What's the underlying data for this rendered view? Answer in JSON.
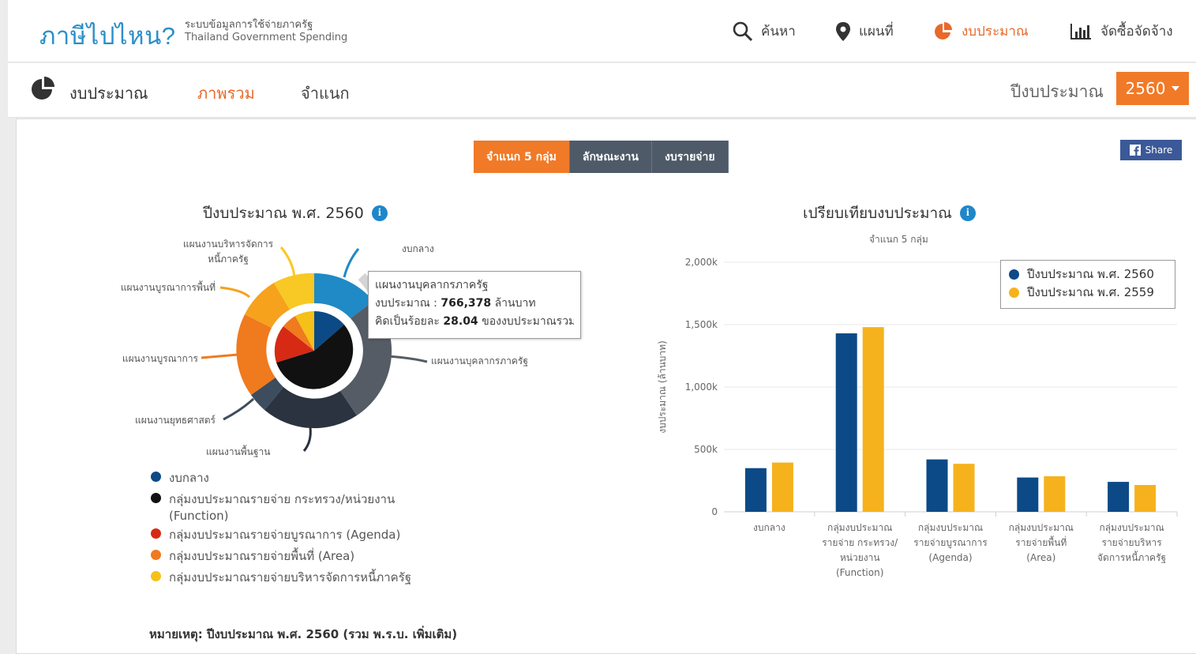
{
  "header": {
    "logo": "ภาษีไปไหน?",
    "subtitle_th": "ระบบข้อมูลการใช้จ่ายภาครัฐ",
    "subtitle_en": "Thailand Government Spending",
    "nav": [
      {
        "label": "ค้นหา",
        "icon": "search-icon"
      },
      {
        "label": "แผนที่",
        "icon": "map-pin-icon"
      },
      {
        "label": "งบประมาณ",
        "icon": "pie-chart-icon",
        "active": true
      },
      {
        "label": "จัดซื้อจัดจ้าง",
        "icon": "bar-chart-icon"
      }
    ]
  },
  "subnav": {
    "title": "งบประมาณ",
    "tabs": [
      {
        "label": "ภาพรวม",
        "active": true
      },
      {
        "label": "จำแนก"
      }
    ],
    "year_label": "ปีงบประมาณ",
    "year_value": "2560"
  },
  "toolbar": {
    "segments": [
      {
        "label": "จำแนก 5 กลุ่ม",
        "active": true
      },
      {
        "label": "ลักษณะงาน"
      },
      {
        "label": "งบรายจ่าย"
      }
    ],
    "share": "Share"
  },
  "donut": {
    "title": "ปีงบประมาณ พ.ศ. 2560",
    "labels": {
      "central": "งบกลาง",
      "admin_debt": [
        "แผนงานบริหารจัดการ",
        "หนี้ภาครัฐ"
      ],
      "area": "แผนงานบูรณาการพื้นที่",
      "integrated": "แผนงานบูรณาการ",
      "strategic": "แผนงานยุทธศาสตร์",
      "basic": "แผนงานพื้นฐาน",
      "personnel": "แผนงานบุคลากรภาครัฐ"
    },
    "tooltip": {
      "name": "แผนงานบุคลากรภาครัฐ",
      "budget_label": "งบประมาณ :",
      "budget_value": "766,378",
      "budget_unit": "ล้านบาท",
      "percent_label": "คิดเป็นร้อยละ",
      "percent_value": "28.04",
      "percent_suffix": "ของงบประมาณรวม"
    },
    "legend": [
      {
        "label": "งบกลาง",
        "color": "#0b4a87"
      },
      {
        "label": "กลุ่มงบประมาณรายจ่าย กระทรวง/หน่วยงาน (Function)",
        "color": "#111111"
      },
      {
        "label": "กลุ่มงบประมาณรายจ่ายบูรณาการ (Agenda)",
        "color": "#d62a14"
      },
      {
        "label": "กลุ่มงบประมาณรายจ่ายพื้นที่ (Area)",
        "color": "#f07a1e"
      },
      {
        "label": "กลุ่มงบประมาณรายจ่ายบริหารจัดการหนี้ภาครัฐ",
        "color": "#f5c118"
      }
    ]
  },
  "bar_chart": {
    "title": "เปรียบเทียบงบประมาณ",
    "subtitle": "จำแนก 5 กลุ่ม"
  },
  "chart_data": {
    "type": "bar",
    "title": "เปรียบเทียบงบประมาณ",
    "subtitle": "จำแนก 5 กลุ่ม",
    "ylabel": "งบประมาณ (ล้านบาท)",
    "ylim": [
      0,
      2000000
    ],
    "yticks": [
      "0",
      "500k",
      "1,000k",
      "1,500k",
      "2,000k"
    ],
    "categories": [
      [
        "งบกลาง"
      ],
      [
        "กลุ่มงบประมาณ",
        "รายจ่าย กระทรวง/",
        "หน่วยงาน",
        "(Function)"
      ],
      [
        "กลุ่มงบประมาณ",
        "รายจ่ายบูรณาการ",
        "(Agenda)"
      ],
      [
        "กลุ่มงบประมาณ",
        "รายจ่ายพื้นที่",
        "(Area)"
      ],
      [
        "กลุ่มงบประมาณ",
        "รายจ่ายบริหาร",
        "จัดการหนี้ภาครัฐ"
      ]
    ],
    "series": [
      {
        "name": "ปีงบประมาณ พ.ศ. 2560",
        "color": "#0b4a87",
        "values": [
          350000,
          1430000,
          420000,
          275000,
          240000
        ]
      },
      {
        "name": "ปีงบประมาณ พ.ศ. 2559",
        "color": "#f6b21d",
        "values": [
          395000,
          1480000,
          385000,
          285000,
          215000
        ]
      }
    ],
    "legend_position": "top-right",
    "grid": true
  },
  "footnote": "หมายเหตุ: ปีงบประมาณ พ.ศ. 2560 (รวม พ.ร.บ. เพิ่มเติม)"
}
